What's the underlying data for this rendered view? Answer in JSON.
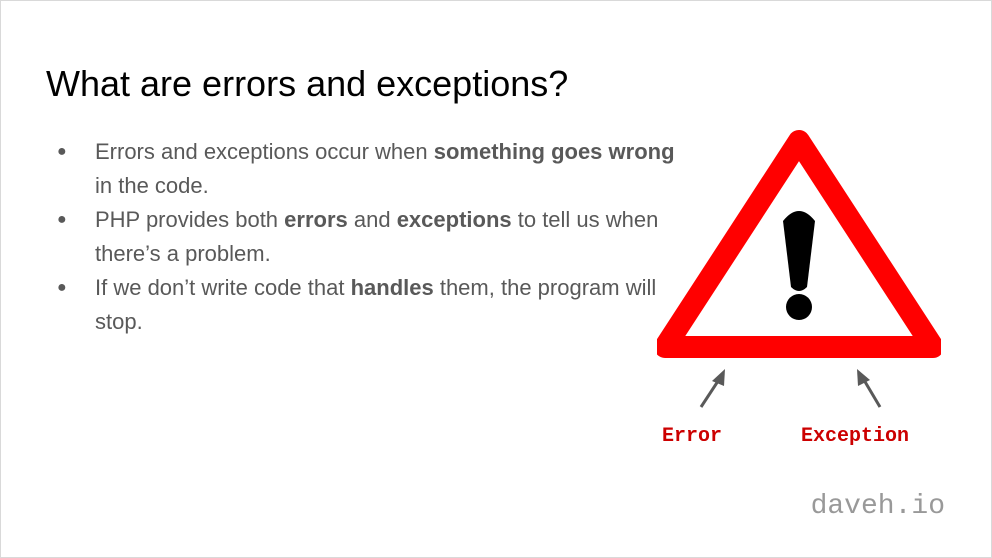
{
  "slide": {
    "title": "What are errors and exceptions?",
    "bullets": [
      {
        "marker": "●",
        "parts": [
          {
            "text": "Errors and exceptions occur when ",
            "bold": false
          },
          {
            "text": "something goes wrong",
            "bold": true
          },
          {
            "text": " in the code.",
            "bold": false
          }
        ]
      },
      {
        "marker": "●",
        "parts": [
          {
            "text": "PHP provides both ",
            "bold": false
          },
          {
            "text": "errors",
            "bold": true
          },
          {
            "text": " and ",
            "bold": false
          },
          {
            "text": "exceptions",
            "bold": true
          },
          {
            "text": " to tell us when there’s a problem.",
            "bold": false
          }
        ]
      },
      {
        "marker": "●",
        "parts": [
          {
            "text": "If we don’t write code that ",
            "bold": false
          },
          {
            "text": "handles",
            "bold": true
          },
          {
            "text": " them, the program will stop.",
            "bold": false
          }
        ]
      }
    ],
    "graphic": {
      "icon": "warning-triangle-icon",
      "labels": {
        "error": "Error",
        "exception": "Exception"
      },
      "colors": {
        "triangle": "#ff0000",
        "label": "#cc0000",
        "arrow": "#595959"
      }
    },
    "brand": "daveh.io"
  }
}
